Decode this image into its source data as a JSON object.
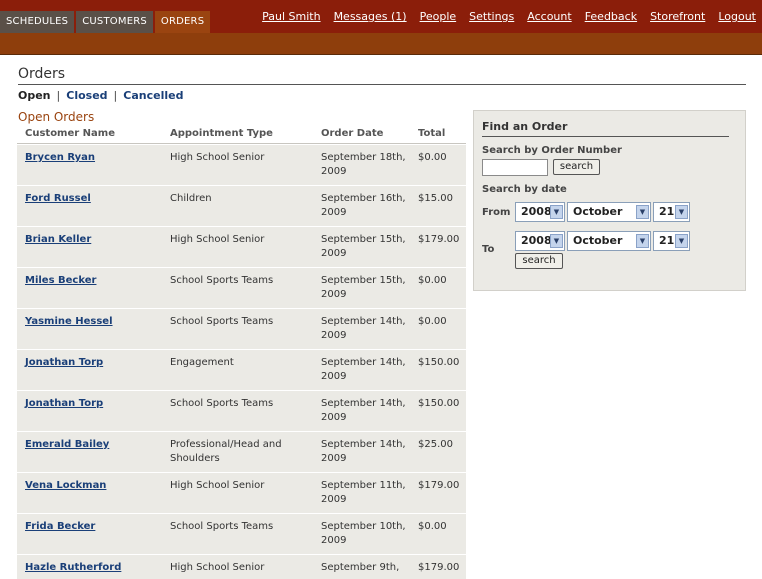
{
  "tabs": [
    "SCHEDULES",
    "CUSTOMERS",
    "ORDERS"
  ],
  "user_nav": [
    "Paul Smith",
    "Messages (1)",
    "People",
    "Settings",
    "Account",
    "Feedback",
    "Storefront",
    "Logout"
  ],
  "page": {
    "title": "Orders",
    "filters": [
      "Open",
      "Closed",
      "Cancelled"
    ],
    "filter_sep": "|",
    "section_title": "Open Orders"
  },
  "table": {
    "headers": [
      "Customer Name",
      "Appointment Type",
      "Order Date",
      "Total"
    ],
    "rows": [
      {
        "name": "Brycen Ryan",
        "type": "High School Senior",
        "date": "September 18th, 2009",
        "total": "$0.00"
      },
      {
        "name": "Ford Russel",
        "type": "Children",
        "date": "September 16th, 2009",
        "total": "$15.00"
      },
      {
        "name": "Brian Keller",
        "type": "High School Senior",
        "date": "September 15th, 2009",
        "total": "$179.00"
      },
      {
        "name": "Miles Becker",
        "type": "School Sports Teams",
        "date": "September 15th, 2009",
        "total": "$0.00"
      },
      {
        "name": "Yasmine Hessel",
        "type": "School Sports Teams",
        "date": "September 14th, 2009",
        "total": "$0.00"
      },
      {
        "name": "Jonathan Torp",
        "type": "Engagement",
        "date": "September 14th, 2009",
        "total": "$150.00"
      },
      {
        "name": "Jonathan Torp",
        "type": "School Sports Teams",
        "date": "September 14th, 2009",
        "total": "$150.00"
      },
      {
        "name": "Emerald Bailey",
        "type": "Professional/Head and Shoulders",
        "date": "September 14th, 2009",
        "total": "$25.00"
      },
      {
        "name": "Vena Lockman",
        "type": "High School Senior",
        "date": "September 11th, 2009",
        "total": "$179.00"
      },
      {
        "name": "Frida Becker",
        "type": "School Sports Teams",
        "date": "September 10th, 2009",
        "total": "$0.00"
      },
      {
        "name": "Hazle Rutherford",
        "type": "High School Senior",
        "date": "September 9th,",
        "total": "$179.00"
      }
    ]
  },
  "find": {
    "title": "Find an Order",
    "by_number_label": "Search by Order Number",
    "order_number_value": "",
    "search_label": "search",
    "by_date_label": "Search by date",
    "from_label": "From",
    "to_label": "To",
    "from": {
      "year": "2008",
      "month": "October",
      "day": "21"
    },
    "to": {
      "year": "2008",
      "month": "October",
      "day": "21"
    }
  },
  "icons": {
    "dropdown": "chevron-down-icon"
  },
  "colors": {
    "header_bar": "#8b1e0a",
    "sub_bar": "#8e3e0c",
    "active_tab": "#9a4410",
    "link": "#1a3f78",
    "section_title": "#9a4410",
    "row_bg": "#ebeae5"
  }
}
